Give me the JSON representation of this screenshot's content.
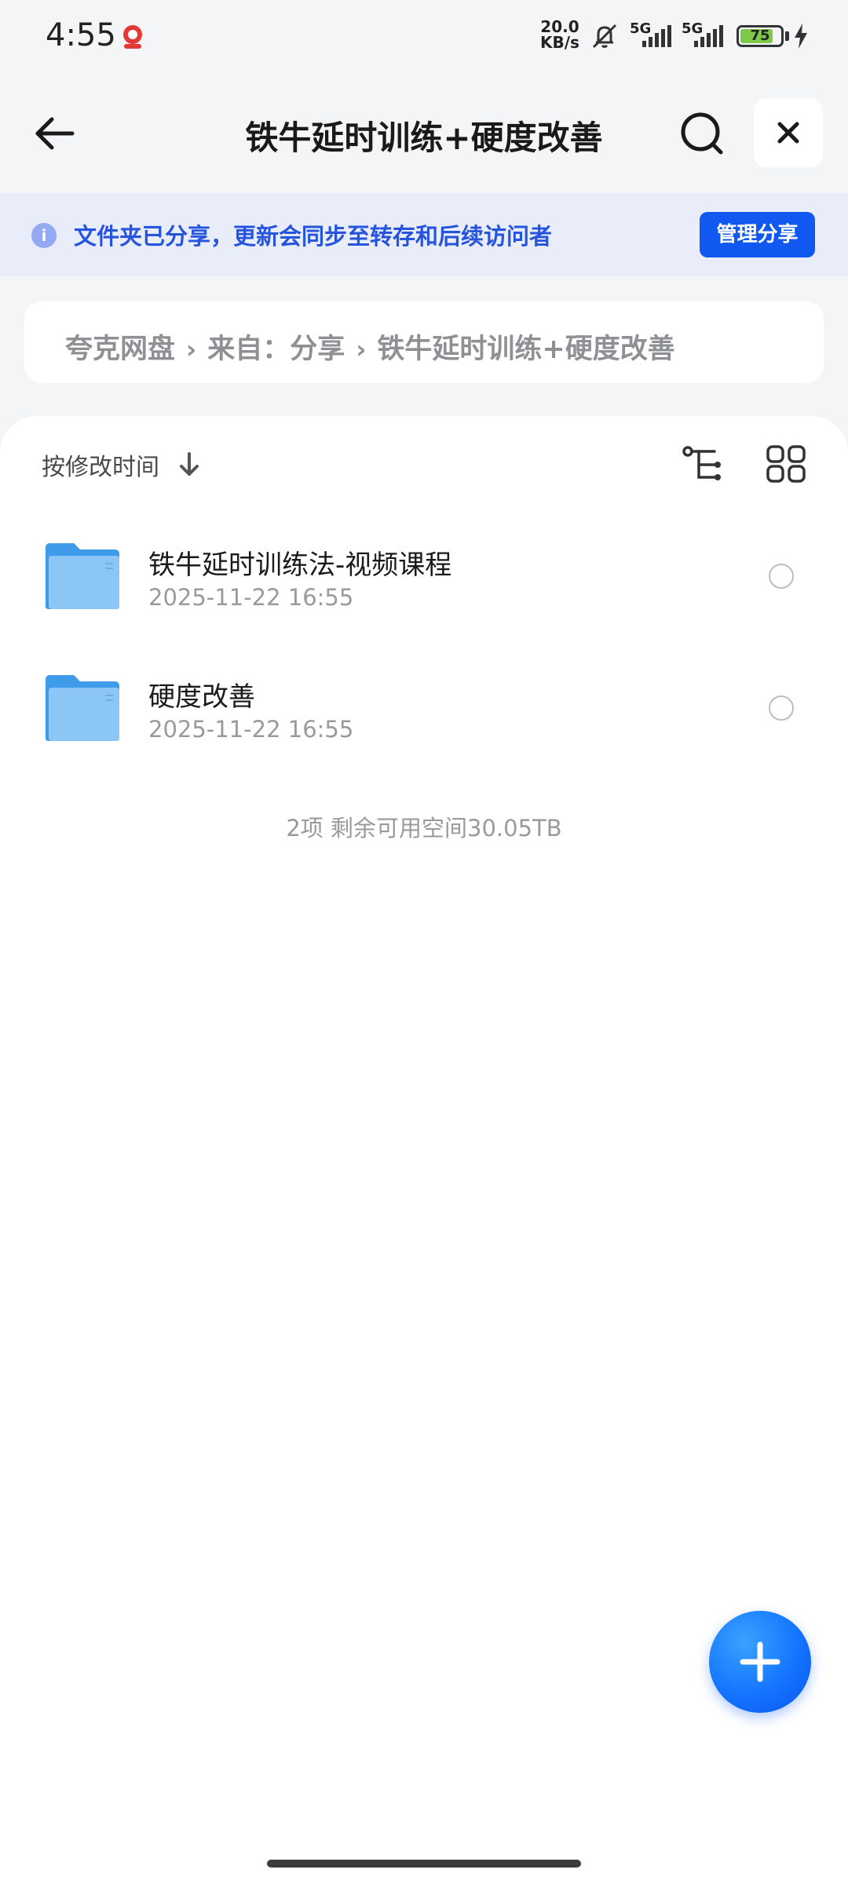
{
  "status_bar": {
    "time": "4:55",
    "net_speed_value": "20.0",
    "net_speed_unit": "KB/s",
    "sim1_label": "5G",
    "sim2_label": "5G",
    "battery_percent": "75",
    "battery_level": 0.75,
    "icons": [
      "app-notification-icon",
      "mute-icon",
      "signal-icon",
      "signal-icon",
      "battery-icon",
      "charging-icon"
    ]
  },
  "header": {
    "title": "铁牛延时训练+硬度改善",
    "icons": [
      "back-arrow-icon",
      "search-icon",
      "close-icon"
    ]
  },
  "share_banner": {
    "text": "文件夹已分享，更新会同步至转存和后续访问者",
    "button_label": "管理分享",
    "info_icon_glyph": "i",
    "accent_color": "#2754dd",
    "button_color": "#1058f0"
  },
  "breadcrumb": {
    "items": [
      "夸克网盘",
      "来自：分享",
      "铁牛延时训练+硬度改善"
    ],
    "separator": "›"
  },
  "toolbar": {
    "sort_label": "按修改时间",
    "icons": [
      "sort-down-icon",
      "tree-view-icon",
      "grid-view-icon"
    ]
  },
  "files": [
    {
      "name": "铁牛延时训练法-视频课程",
      "date": "2025-11-22 16:55",
      "type": "folder"
    },
    {
      "name": "硬度改善",
      "date": "2025-11-22 16:55",
      "type": "folder"
    }
  ],
  "summary": "2项 剩余可用空间30.05TB",
  "fab": {
    "icon": "plus-icon",
    "color": "#1474ff"
  }
}
